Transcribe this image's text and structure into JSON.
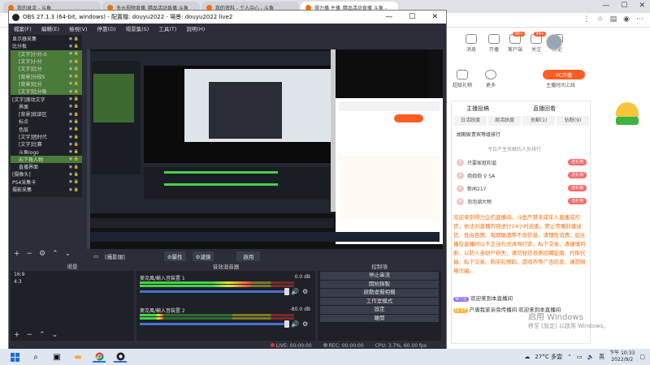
{
  "browser": {
    "tabs": [
      {
        "label": "我的录流 - 斗鱼",
        "active": false
      },
      {
        "label": "多元视频直播_精品活动直播 斗鱼",
        "active": false
      },
      {
        "label": "我的资料 - 个人中心 - 斗鱼",
        "active": false
      },
      {
        "label": "得力播 主播_精品活动直播 斗鱼 -",
        "active": true
      }
    ],
    "controls": [
      "—",
      "☐",
      "✕"
    ]
  },
  "douyu": {
    "nav": [
      {
        "label": "消息",
        "badge": ""
      },
      {
        "label": "开播",
        "badge": ""
      },
      {
        "label": "客户端",
        "badge": "99+"
      },
      {
        "label": "关注",
        "badge": "99+"
      },
      {
        "label": "历史",
        "badge": ""
      }
    ],
    "more_left": "超级礼物",
    "more_right": "更多",
    "pc_start": "PC开播",
    "pc_sub": "主播时间上线",
    "tabs": [
      "主播投稿",
      "直播回看"
    ],
    "rank_tabs": [
      "日活跃度",
      "周活跃度",
      "贡献(1)",
      "钻粉(9)"
    ],
    "rank_header": "胡期家贵宾等级排行",
    "rank_empty": "今日产生贡献的人员排行",
    "ranks": [
      {
        "num": "1",
        "name": "只要家庭和谐",
        "btn": "送礼物"
      },
      {
        "num": "2",
        "name": "炮炮炮 ♀ SA",
        "btn": "送礼物"
      },
      {
        "num": "3",
        "name": "新闻217",
        "btn": "送礼物"
      },
      {
        "num": "4",
        "name": "泡泡湖大物",
        "btn": "送礼物"
      }
    ],
    "chat_notice": "欢迎来到得力企的直播间。斗鱼严禁未成年人直播或打赏，依法对直播内容进行24小时巡查，禁止传播封建迷信、低俗色情、吸烟酗酒等不良信息，请理性消费，如主播在直播时以不正当方式诱导打赏，私下交易，请谨慎判断，以防人身财产损失，请勿轻信各类招聘征婚、代练代抽、私下交易、购买礼物码、游戏币等广告信息，谨防网络诈骗。",
    "chat_lines": [
      {
        "tag": "得力企",
        "text": "欢迎来到本直播间"
      },
      {
        "tag": "LV 27",
        "text": "户唐我家亲旁传播间 欢迎来到本直播间"
      }
    ],
    "activate_title": "启用 Windows",
    "activate_sub": "移至 [設定] 以啟用 Windows。"
  },
  "obs": {
    "title": "OBS 27.1.3 (64-bit, windows) - 配置檔: douyu2022 - 場景: douyu2022 live2",
    "window_controls": [
      "—",
      "☐",
      "✕"
    ],
    "menu": [
      "檔案(F)",
      "編輯(E)",
      "檢視(V)",
      "停靠(D)",
      "場景集(S)",
      "工具(T)",
      "說明(H)"
    ],
    "sources": [
      {
        "label": "显示器采集",
        "sel": false,
        "hdr": true
      },
      {
        "label": "比分板",
        "sel": false,
        "hdr": true
      },
      {
        "label": "[文字]小分-0",
        "sel": true,
        "hdr": false
      },
      {
        "label": "[文字]小分",
        "sel": true,
        "hdr": false
      },
      {
        "label": "[文字]比分",
        "sel": true,
        "hdr": false
      },
      {
        "label": "[背景]分段5",
        "sel": true,
        "hdr": false
      },
      {
        "label": "[背景]比分",
        "sel": true,
        "hdr": false
      },
      {
        "label": "[文字]比分板",
        "sel": true,
        "hdr": false
      },
      {
        "label": "[文字]滚动文字",
        "sel": false,
        "hdr": true
      },
      {
        "label": "界面",
        "sel": false,
        "hdr": false
      },
      {
        "label": "[背景]底部区",
        "sel": false,
        "hdr": false
      },
      {
        "label": "标点",
        "sel": false,
        "hdr": false
      },
      {
        "label": "色层",
        "sel": false,
        "hdr": false
      },
      {
        "label": "[文字]团时代",
        "sel": false,
        "hdr": false
      },
      {
        "label": "[文字]比赛",
        "sel": false,
        "hdr": false
      },
      {
        "label": "斗鱼logo",
        "sel": false,
        "hdr": false
      },
      {
        "label": "右下角人物",
        "sel": true,
        "hdr": false
      },
      {
        "label": "直播界面",
        "sel": false,
        "hdr": false
      },
      {
        "label": "[摄像头]",
        "sel": false,
        "hdr": true
      },
      {
        "label": "PS4采集卡",
        "sel": false,
        "hdr": true
      },
      {
        "label": "摄影采集",
        "sel": false,
        "hdr": true
      }
    ],
    "source_bar": {
      "name": "[攝影頭]",
      "props": "⚙屬性",
      "filters": "⚙濾鏡",
      "extra": "啟用"
    },
    "scenes_header": "場景",
    "scenes": [
      "16:9",
      "4:3"
    ],
    "mixer_header": "音效混音器",
    "tracks": [
      {
        "name": "麥克風/輸入音裝置 1",
        "db": "0.0 dB",
        "level": 0.72
      },
      {
        "name": "麥克風/輸入音裝置 2",
        "db": "-80.0 dB",
        "level": 0.15
      }
    ],
    "controls_header": "控制項",
    "controls": [
      "停止串流",
      "開始錄製",
      "啟動虛擬相機",
      "工作室模式",
      "設定",
      "離開"
    ],
    "status": {
      "live": "LIVE: 00:00:00",
      "rec": "REC: 00:00:00",
      "cpu": "CPU: 3.7%, 60.00 fps"
    }
  },
  "taskbar": {
    "weather": "27°C 多雲",
    "lang": "英",
    "time": "下午 10:33",
    "date": "2022/9/2"
  }
}
